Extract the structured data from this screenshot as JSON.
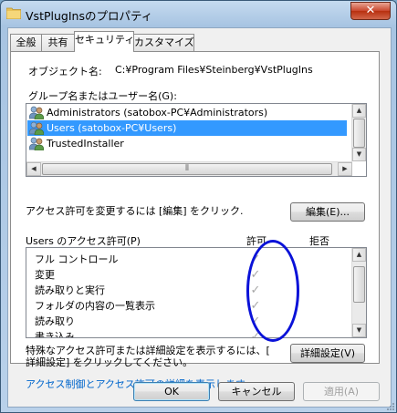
{
  "window": {
    "title": "VstPlugInsのプロパティ",
    "close_label": "✕"
  },
  "tabs": [
    {
      "label": "全般",
      "active": false
    },
    {
      "label": "共有",
      "active": false
    },
    {
      "label": "セキュリティ",
      "active": true
    },
    {
      "label": "カスタマイズ",
      "active": false
    }
  ],
  "object": {
    "label": "オブジェクト名:",
    "value": "C:¥Program Files¥Steinberg¥VstPlugIns"
  },
  "groups": {
    "label": "グループ名またはユーザー名(G):",
    "items": [
      {
        "name": "Administrators (satobox-PC¥Administrators)",
        "selected": false
      },
      {
        "name": "Users (satobox-PC¥Users)",
        "selected": true
      },
      {
        "name": "TrustedInstaller",
        "selected": false
      }
    ],
    "hscroll_grip": "⦀"
  },
  "change_perm": {
    "text": "アクセス許可を変更するには [編集] をクリック.",
    "edit_button": "編集(E)..."
  },
  "permissions": {
    "header": "Users のアクセス許可(P)",
    "allow_header": "許可",
    "deny_header": "拒否",
    "check_glyph": "✓",
    "items": [
      {
        "name": "フル コントロール",
        "allow": true,
        "deny": false
      },
      {
        "name": "変更",
        "allow": true,
        "deny": false
      },
      {
        "name": "読み取りと実行",
        "allow": true,
        "deny": false
      },
      {
        "name": "フォルダの内容の一覧表示",
        "allow": true,
        "deny": false
      },
      {
        "name": "読み取り",
        "allow": true,
        "deny": false
      },
      {
        "name": "書き込み",
        "allow": true,
        "deny": false
      }
    ]
  },
  "advanced": {
    "text_line1": "特殊なアクセス許可または詳細設定を表示するには、[",
    "text_line2": "詳細設定] をクリックしてください。",
    "button": "詳細設定(V)"
  },
  "help_link": "アクセス制御とアクセス許可の詳細を表示します。",
  "footer": {
    "ok": "OK",
    "cancel": "キャンセル",
    "apply": "適用(A)"
  },
  "colors": {
    "selection": "#3399ff",
    "link": "#0066cc",
    "annotation_circle": "#0a12d8",
    "close_button": "#c9462c"
  }
}
